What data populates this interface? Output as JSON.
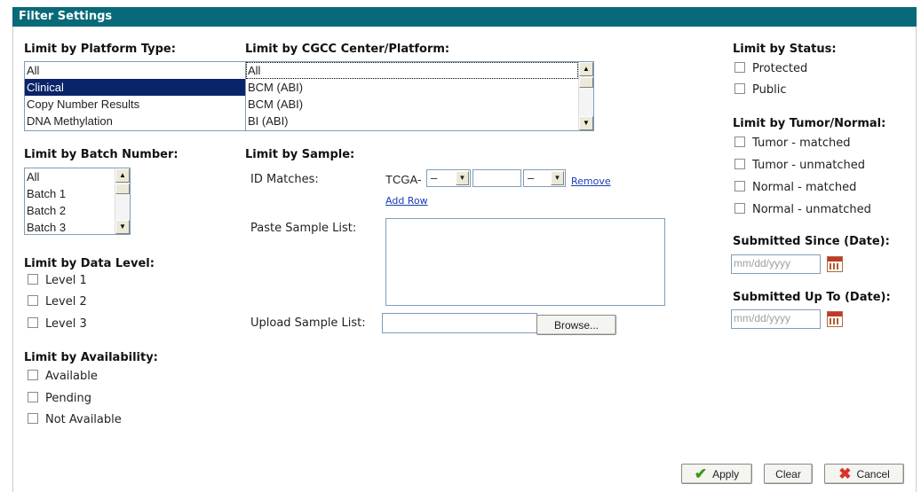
{
  "title": "Filter Settings",
  "platform": {
    "heading": "Limit by Platform Type:",
    "options": [
      "All",
      "Clinical",
      "Copy Number Results",
      "DNA Methylation"
    ],
    "selected_index": 1
  },
  "center": {
    "heading": "Limit by CGCC Center/Platform:",
    "options": [
      "All",
      "BCM (ABI)",
      "BCM (ABI)",
      "BI (ABI)"
    ]
  },
  "batch": {
    "heading": "Limit by Batch Number:",
    "options": [
      "All",
      "Batch 1",
      "Batch 2",
      "Batch 3"
    ]
  },
  "data_level": {
    "heading": "Limit by Data Level:",
    "options": [
      "Level 1",
      "Level 2",
      "Level 3"
    ]
  },
  "availability": {
    "heading": "Limit by Availability:",
    "options": [
      "Available",
      "Pending",
      "Not Available"
    ]
  },
  "sample": {
    "heading": "Limit by Sample:",
    "id_label": "ID Matches:",
    "id_prefix": "TCGA-",
    "select1_value": "–",
    "select2_value": "–",
    "remove_label": "Remove",
    "add_row_label": "Add Row",
    "paste_label": "Paste Sample List:",
    "upload_label": "Upload Sample List:",
    "browse_label": "Browse..."
  },
  "status": {
    "heading": "Limit by Status:",
    "options": [
      "Protected",
      "Public"
    ]
  },
  "tumor": {
    "heading": "Limit by Tumor/Normal:",
    "options": [
      "Tumor - matched",
      "Tumor - unmatched",
      "Normal - matched",
      "Normal - unmatched"
    ]
  },
  "since": {
    "heading": "Submitted Since (Date):",
    "placeholder": "mm/dd/yyyy"
  },
  "upto": {
    "heading": "Submitted Up To (Date):",
    "placeholder": "mm/dd/yyyy"
  },
  "buttons": {
    "apply": "Apply",
    "clear": "Clear",
    "cancel": "Cancel"
  },
  "colors": {
    "titlebar": "#086a78",
    "selection": "#0a246a",
    "link": "#1a3db0"
  }
}
